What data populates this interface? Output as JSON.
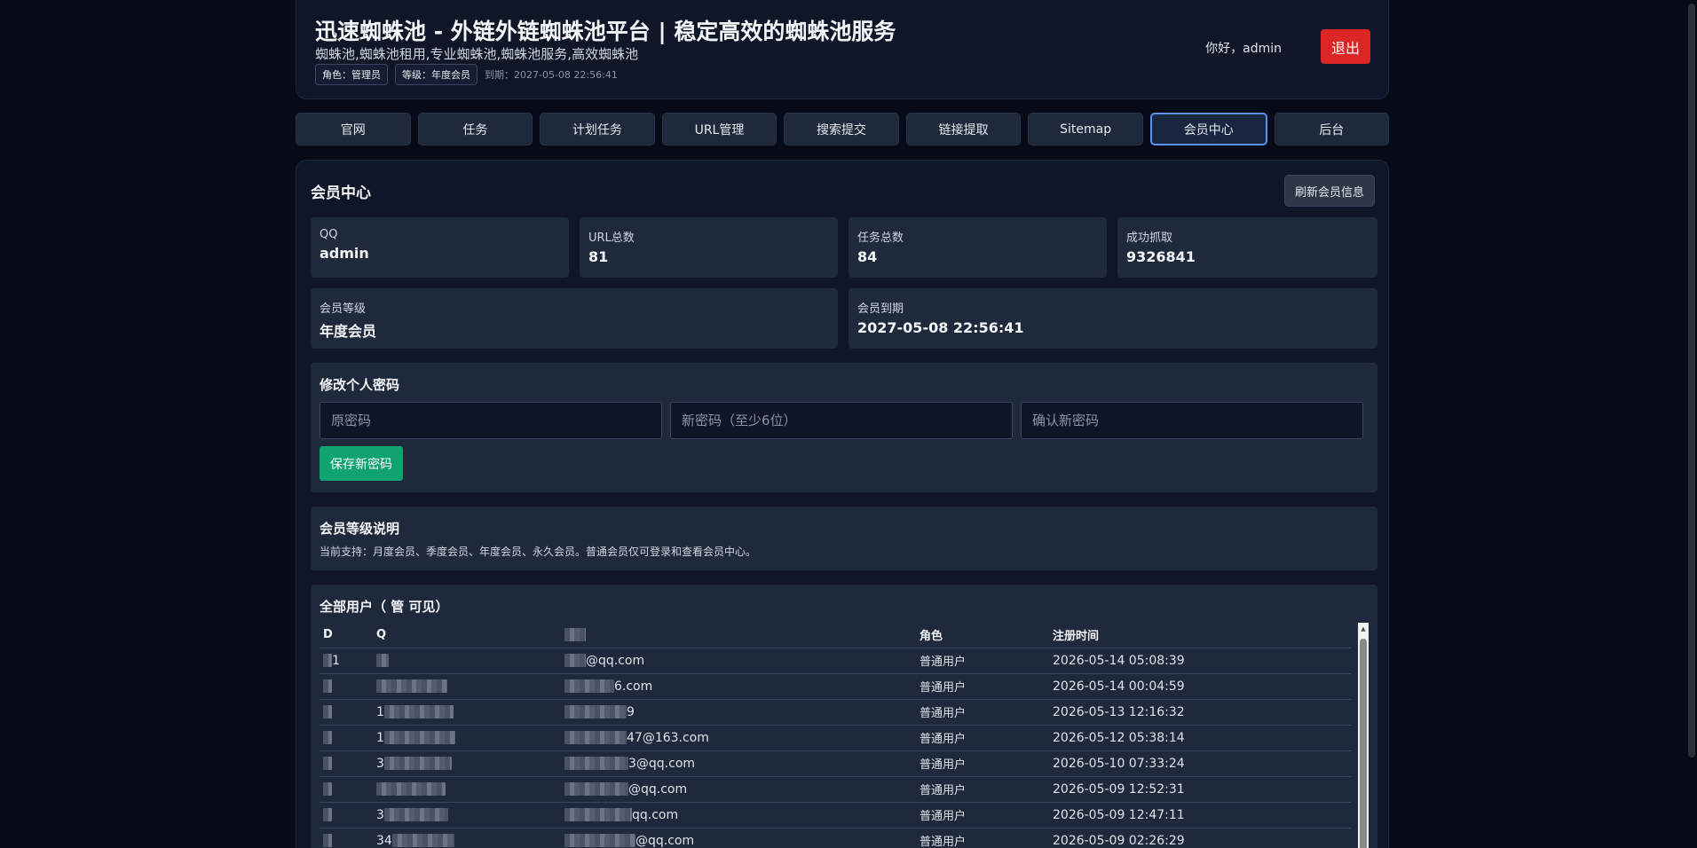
{
  "header": {
    "title": "迅速蜘蛛池 - 外链外链蜘蛛池平台 | 稳定高效的蜘蛛池服务",
    "subtitle": "蜘蛛池,蜘蛛池租用,专业蜘蛛池,蜘蛛池服务,高效蜘蛛池",
    "role_badge": "角色：管理员",
    "level_badge": "等级：年度会员",
    "expire": "到期：2027-05-08 22:56:41",
    "greeting": "你好，admin",
    "logout_label": "退出"
  },
  "nav": {
    "tabs": [
      {
        "label": "官网"
      },
      {
        "label": "任务"
      },
      {
        "label": "计划任务"
      },
      {
        "label": "URL管理"
      },
      {
        "label": "搜索提交"
      },
      {
        "label": "链接提取"
      },
      {
        "label": "Sitemap"
      },
      {
        "label": "会员中心",
        "active": true
      },
      {
        "label": "后台"
      }
    ]
  },
  "member": {
    "title": "会员中心",
    "refresh_label": "刷新会员信息",
    "stats": [
      {
        "label": "QQ",
        "value": "admin"
      },
      {
        "label": "URL总数",
        "value": "81"
      },
      {
        "label": "任务总数",
        "value": "84"
      },
      {
        "label": "成功抓取",
        "value": "9326841"
      },
      {
        "label": "会员等级",
        "value": "年度会员"
      },
      {
        "label": "会员到期",
        "value": "2027-05-08 22:56:41"
      }
    ]
  },
  "password": {
    "title": "修改个人密码",
    "old_placeholder": "原密码",
    "new_placeholder": "新密码（至少6位）",
    "confirm_placeholder": "确认新密码",
    "save_label": "保存新密码"
  },
  "levels": {
    "title": "会员等级说明",
    "desc": "当前支持：月度会员、季度会员、年度会员、永久会员。普通会员仅可登录和查看会员中心。"
  },
  "users": {
    "title": "全部用户（ 管 可见）",
    "columns": [
      "D",
      "Q",
      "",
      "角色",
      "注册时间"
    ],
    "rows": [
      {
        "id": "1",
        "qq": "",
        "email": "@qq.com",
        "role": "普通用户",
        "time": "2026-05-14 05:08:39"
      },
      {
        "id": "",
        "qq": "",
        "email": "6.com",
        "role": "普通用户",
        "time": "2026-05-14 00:04:59"
      },
      {
        "id": "",
        "qq": "1",
        "email": "9",
        "role": "普通用户",
        "time": "2026-05-13 12:16:32"
      },
      {
        "id": "",
        "qq": "1",
        "email": "47@163.com",
        "role": "普通用户",
        "time": "2026-05-12 05:38:14"
      },
      {
        "id": "",
        "qq": "3",
        "email": "3@qq.com",
        "role": "普通用户",
        "time": "2026-05-10 07:33:24"
      },
      {
        "id": "",
        "qq": "",
        "email": "@qq.com",
        "role": "普通用户",
        "time": "2026-05-09 12:52:31"
      },
      {
        "id": "",
        "qq": "3",
        "email": "qq.com",
        "role": "普通用户",
        "time": "2026-05-09 12:47:11"
      },
      {
        "id": "",
        "qq": "34",
        "email": "@qq.com",
        "role": "普通用户",
        "time": "2026-05-09 02:26:29"
      }
    ]
  }
}
